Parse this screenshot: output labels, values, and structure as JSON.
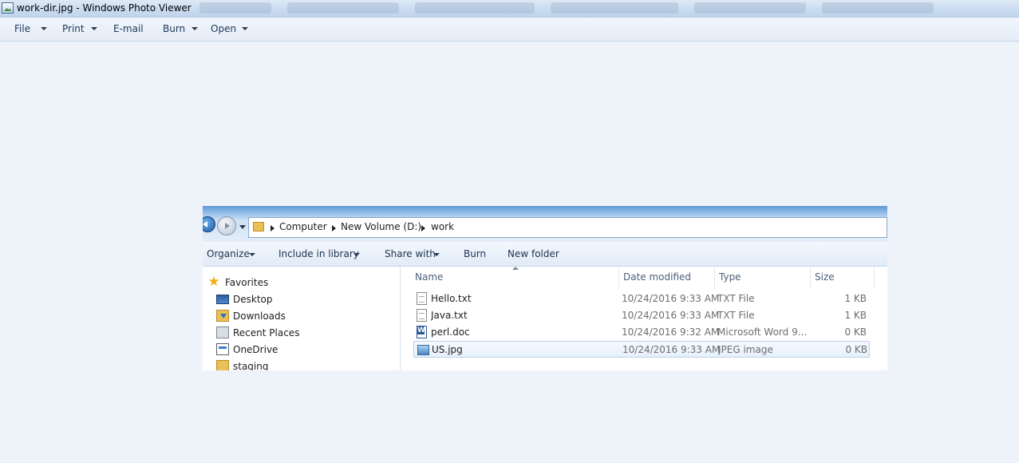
{
  "window": {
    "title": "work-dir.jpg - Windows Photo Viewer",
    "icon": "photo-viewer-icon"
  },
  "menu": [
    {
      "label": "File",
      "has_dropdown": true
    },
    {
      "label": "Print",
      "has_dropdown": true
    },
    {
      "label": "E-mail",
      "has_dropdown": false
    },
    {
      "label": "Burn",
      "has_dropdown": true
    },
    {
      "label": "Open",
      "has_dropdown": true
    }
  ],
  "explorer": {
    "breadcrumb": [
      "Computer",
      "New Volume (D:)",
      "work"
    ],
    "commands": [
      {
        "label": "Organize",
        "has_dropdown": true
      },
      {
        "label": "Include in library",
        "has_dropdown": true
      },
      {
        "label": "Share with",
        "has_dropdown": true
      },
      {
        "label": "Burn",
        "has_dropdown": false
      },
      {
        "label": "New folder",
        "has_dropdown": false
      }
    ],
    "nav_items": [
      {
        "label": "Favorites",
        "icon": "star-icon"
      },
      {
        "label": "Desktop",
        "icon": "desktop-icon"
      },
      {
        "label": "Downloads",
        "icon": "downloads-icon"
      },
      {
        "label": "Recent Places",
        "icon": "recent-places-icon"
      },
      {
        "label": "OneDrive",
        "icon": "onedrive-icon"
      },
      {
        "label": "staging",
        "icon": "folder-icon"
      }
    ],
    "columns": [
      "Name",
      "Date modified",
      "Type",
      "Size"
    ],
    "files": [
      {
        "name": "Hello.txt",
        "date": "10/24/2016 9:33 AM",
        "type": "TXT File",
        "size": "1 KB",
        "icon": "text-file-icon"
      },
      {
        "name": "Java.txt",
        "date": "10/24/2016 9:33 AM",
        "type": "TXT File",
        "size": "1 KB",
        "icon": "text-file-icon"
      },
      {
        "name": "perl.doc",
        "date": "10/24/2016 9:32 AM",
        "type": "Microsoft Word 9...",
        "size": "0 KB",
        "icon": "word-doc-icon"
      },
      {
        "name": "US.jpg",
        "date": "10/24/2016 9:33 AM",
        "type": "JPEG image",
        "size": "0 KB",
        "icon": "jpeg-image-icon",
        "selected": true
      }
    ]
  },
  "colors": {
    "viewer_background": "#eef2f9",
    "selection_border": "#b9d1ec",
    "nav_gradient_top": "#5f97d5"
  }
}
